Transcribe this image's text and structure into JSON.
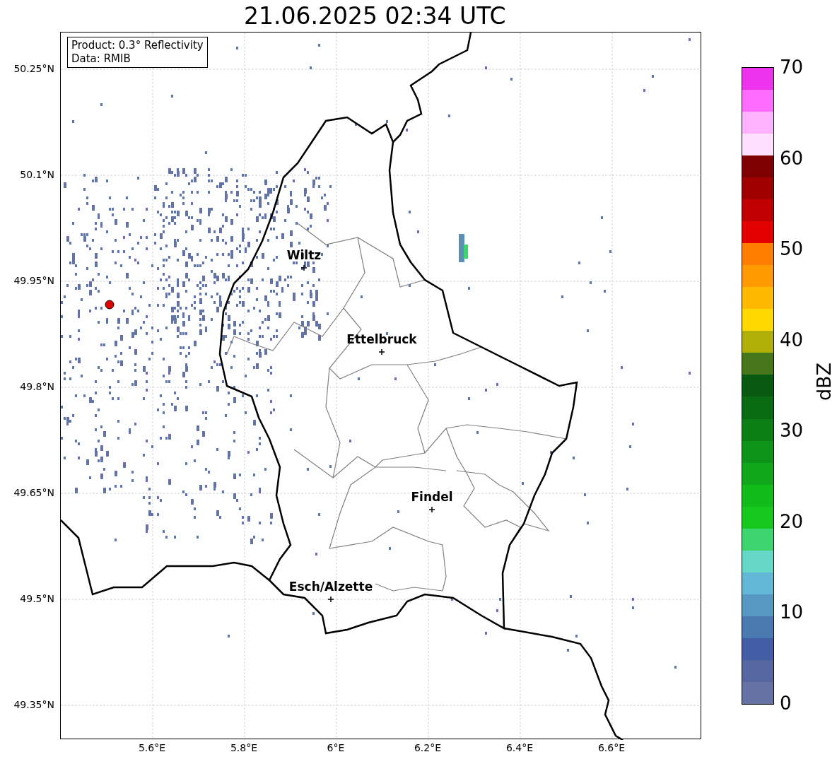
{
  "title": "21.06.2025 02:34 UTC",
  "legend": [
    "Product: 0.3° Reflectivity",
    "Data: RMIB"
  ],
  "yticks": [
    "50.25°N",
    "50.1°N",
    "49.95°N",
    "49.8°N",
    "49.65°N",
    "49.5°N",
    "49.35°N"
  ],
  "xticks": [
    "5.6°E",
    "5.8°E",
    "6°E",
    "6.2°E",
    "6.4°E",
    "6.6°E"
  ],
  "cities": [
    {
      "name": "Wiltz"
    },
    {
      "name": "Ettelbruck"
    },
    {
      "name": "Findel"
    },
    {
      "name": "Esch/Alzette"
    }
  ],
  "colorbar": {
    "label": "dBZ",
    "ticks": [
      "70",
      "60",
      "50",
      "40",
      "30",
      "20",
      "10",
      "0"
    ],
    "segments": [
      {
        "color": "#ee33ee"
      },
      {
        "color": "#ff6cff"
      },
      {
        "color": "#ffb2ff"
      },
      {
        "color": "#ffe0ff"
      },
      {
        "color": "#7e0000"
      },
      {
        "color": "#a00000"
      },
      {
        "color": "#c00000"
      },
      {
        "color": "#e50000"
      },
      {
        "color": "#ff7e00"
      },
      {
        "color": "#ff9a00"
      },
      {
        "color": "#ffba00"
      },
      {
        "color": "#ffd800"
      },
      {
        "color": "#b1b009"
      },
      {
        "color": "#46771a"
      },
      {
        "color": "#085a10"
      },
      {
        "color": "#0a6c12"
      },
      {
        "color": "#0b7e14"
      },
      {
        "color": "#0e9418"
      },
      {
        "color": "#10a81a"
      },
      {
        "color": "#12bc1a"
      },
      {
        "color": "#16c91c"
      },
      {
        "color": "#3dd66e"
      },
      {
        "color": "#66d8c8"
      },
      {
        "color": "#62b8d6"
      },
      {
        "color": "#5798c0"
      },
      {
        "color": "#4a7ab0"
      },
      {
        "color": "#435ea4"
      },
      {
        "color": "#5566a0"
      },
      {
        "color": "#6473a4"
      }
    ]
  }
}
